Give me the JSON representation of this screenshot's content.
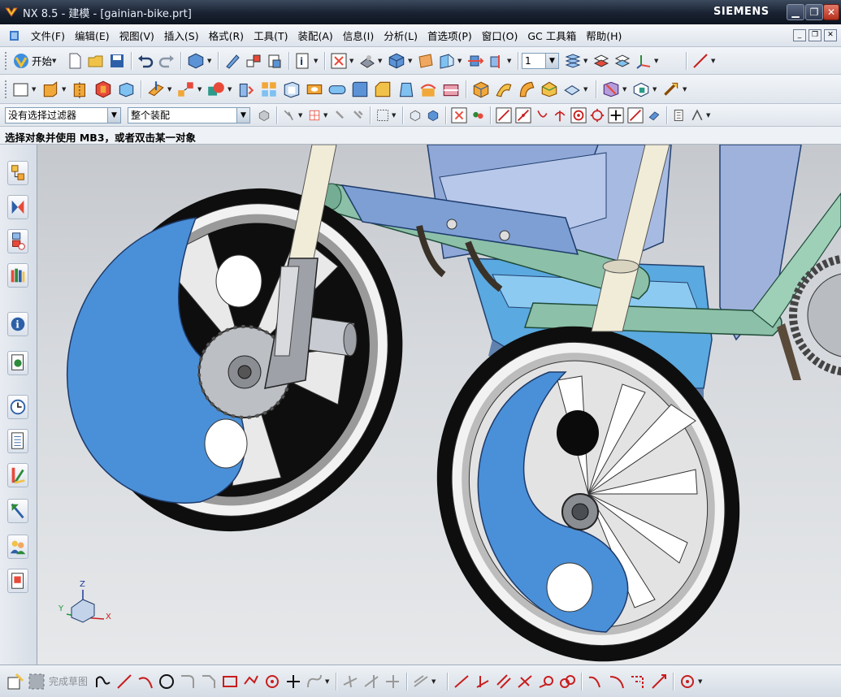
{
  "window": {
    "title": "NX 8.5 - 建模 - [gainian-bike.prt]",
    "brand": "SIEMENS",
    "buttons": {
      "minimize": "▁",
      "restore": "❐",
      "close": "✕"
    }
  },
  "menubar": {
    "items": [
      "文件(F)",
      "编辑(E)",
      "视图(V)",
      "插入(S)",
      "格式(R)",
      "工具(T)",
      "装配(A)",
      "信息(I)",
      "分析(L)",
      "首选项(P)",
      "窗口(O)",
      "GC 工具箱",
      "帮助(H)"
    ]
  },
  "toolbar": {
    "start_label": "开始",
    "layer_value": "1",
    "selection_filter": "没有选择过滤器",
    "assembly_scope": "整个装配"
  },
  "cue_line": "选择对象并使用 MB3，或者双击某一对象",
  "resource_bar": {
    "icons": [
      "assembly-navigator-icon",
      "constraint-navigator-icon",
      "part-navigator-icon",
      "reuse-library-icon",
      "hd3d-tools-icon",
      "web-browser-icon",
      "history-icon",
      "system-materials-icon",
      "process-studio-icon",
      "manufacturing-wizard-icon",
      "roles-icon",
      "system-scenes-icon"
    ]
  },
  "triad": {
    "x": "X",
    "y": "Y",
    "z": "Z"
  },
  "sketch_bar": {
    "finish_label": "完成草图"
  },
  "colors": {
    "wheel_blue": "#4a90d8",
    "frame_green": "#8cc0a8",
    "frame_blue": "#8fa8d8",
    "tire_black": "#0e0e0e"
  }
}
